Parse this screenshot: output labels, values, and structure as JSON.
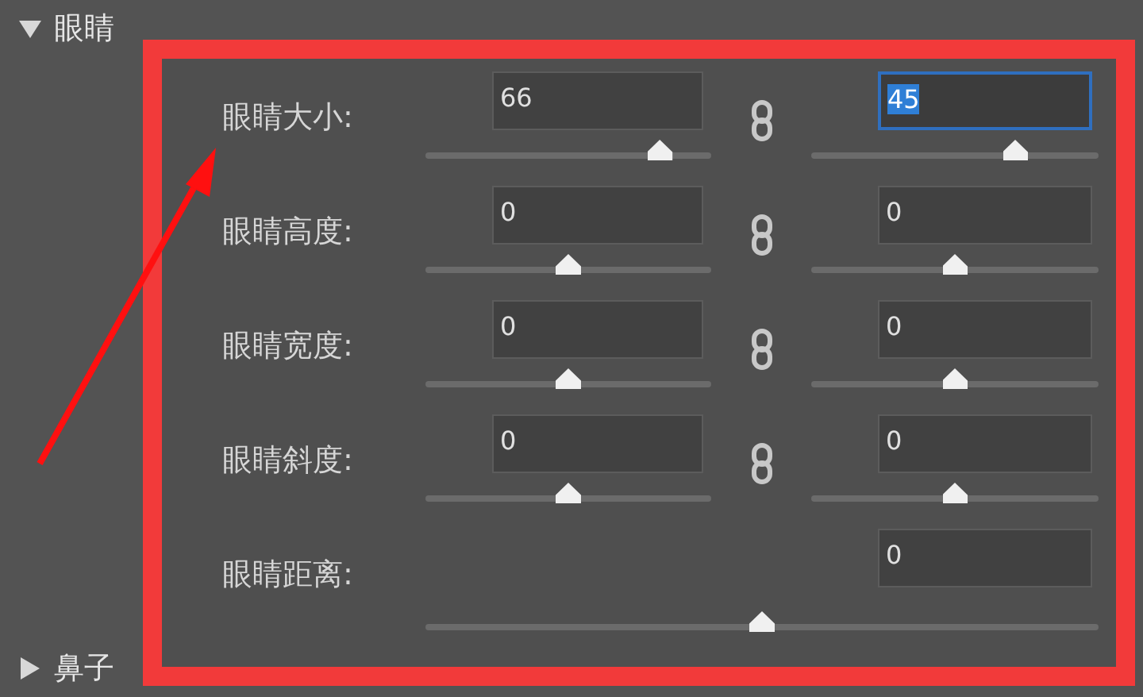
{
  "sections": [
    {
      "title": "眼睛",
      "expanded": true
    },
    {
      "title": "鼻子",
      "expanded": false
    }
  ],
  "eye_controls": [
    {
      "kind": "pair",
      "label": "眼睛大小:",
      "linked": true,
      "left": {
        "value": "66",
        "level": 0.82,
        "focused": false
      },
      "right": {
        "value": "45",
        "level": 0.71,
        "focused": true
      }
    },
    {
      "kind": "pair",
      "label": "眼睛高度:",
      "linked": true,
      "left": {
        "value": "0",
        "level": 0.5,
        "focused": false
      },
      "right": {
        "value": "0",
        "level": 0.5,
        "focused": false
      }
    },
    {
      "kind": "pair",
      "label": "眼睛宽度:",
      "linked": true,
      "left": {
        "value": "0",
        "level": 0.5,
        "focused": false
      },
      "right": {
        "value": "0",
        "level": 0.5,
        "focused": false
      }
    },
    {
      "kind": "pair",
      "label": "眼睛斜度:",
      "linked": true,
      "left": {
        "value": "0",
        "level": 0.5,
        "focused": false
      },
      "right": {
        "value": "0",
        "level": 0.5,
        "focused": false
      }
    },
    {
      "kind": "single",
      "label": "眼睛距离:",
      "value": "0",
      "level": 0.5,
      "focused": false
    }
  ]
}
